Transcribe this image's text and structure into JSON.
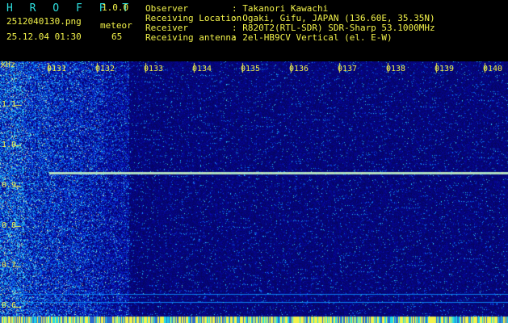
{
  "header": {
    "app_name": "H R O F F T",
    "version": "1.0.0",
    "filename": "2512040130.png",
    "timestamp": "25.12.04 01:30",
    "meteor_label": "meteor",
    "meteor_count": "65",
    "info_labels": [
      "Observer",
      "Receiving Location",
      "Receiver",
      "Receiving antenna"
    ],
    "info_values": [
      ": Takanori Kawachi",
      ": Ogaki, Gifu, JAPAN (136.60E, 35.35N)",
      ": R820T2(RTL-SDR) SDR-Sharp 53.1000MHz",
      ": 2el-HB9CV Vertical (el. E-W)"
    ]
  },
  "spectrogram": {
    "y_unit": "kHz",
    "y_ticks": [
      "1.1",
      "1.0",
      "0.9",
      "0.8",
      "0.7",
      "0.6"
    ],
    "time_ticks": [
      "0131",
      "0132",
      "0133",
      "0134",
      "0135",
      "0136",
      "0137",
      "0138",
      "0139",
      "0140"
    ],
    "colors": {
      "background": "#0a0a6e",
      "noise": "#1f3fc8",
      "signal": "#59e0ff",
      "axis": "#f2f24a"
    }
  }
}
